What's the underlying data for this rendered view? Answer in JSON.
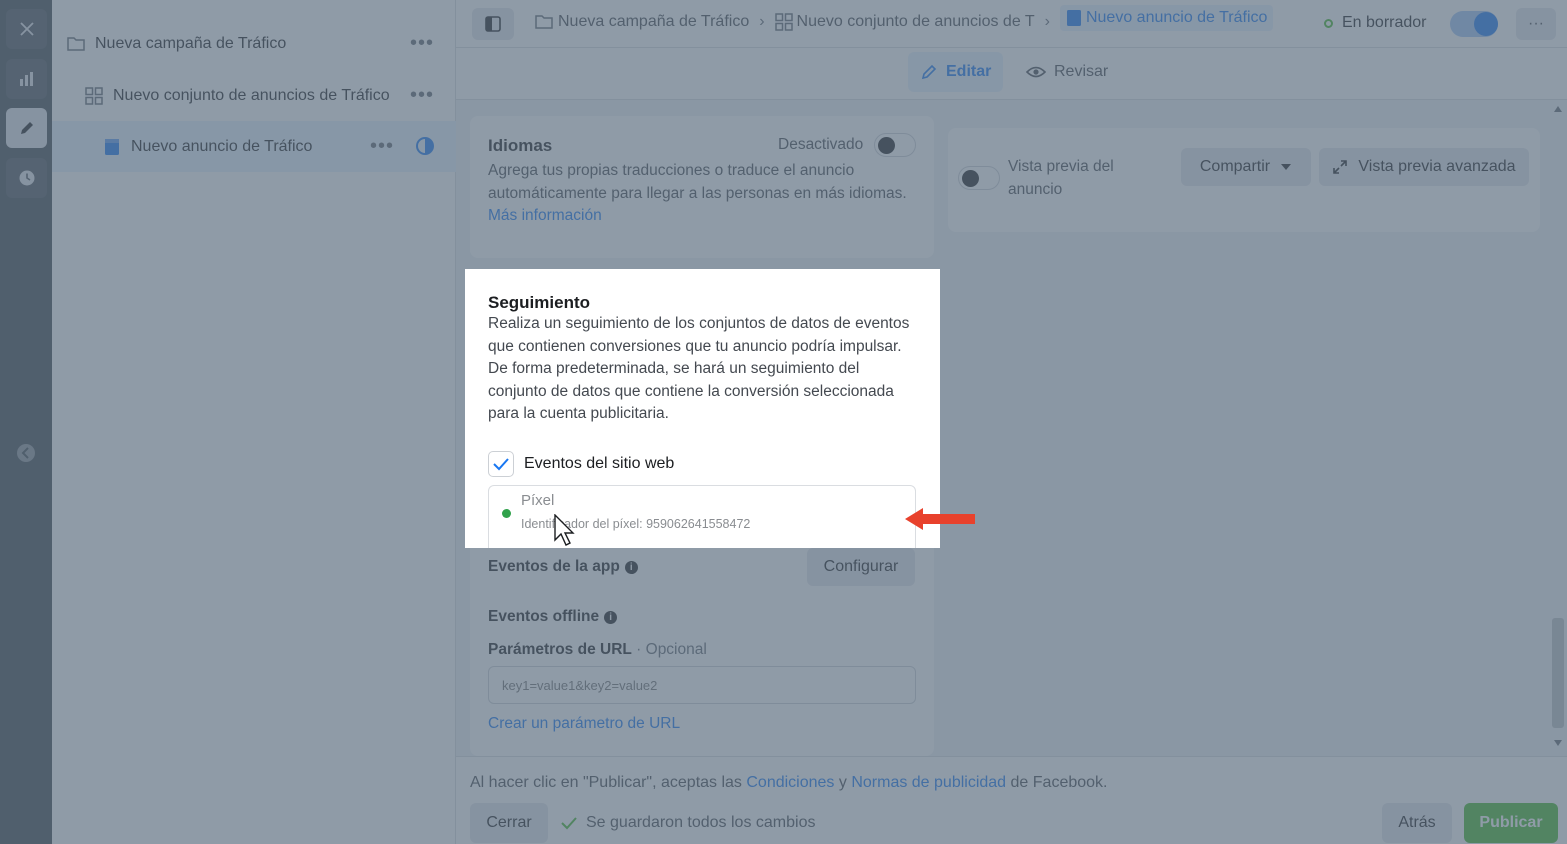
{
  "tree": {
    "campaign": "Nueva campaña de Tráfico",
    "adset": "Nuevo conjunto de anuncios de Tráfico",
    "ad": "Nuevo anuncio de Tráfico",
    "more": "•••"
  },
  "topbar": {
    "crumb_campaign": "Nueva campaña de Tráfico",
    "crumb_adset": "Nuevo conjunto de anuncios de T",
    "crumb_ad": "Nuevo anuncio de Tráfico",
    "status": "En borrador",
    "more": "···"
  },
  "modes": {
    "edit": "Editar",
    "review": "Revisar"
  },
  "languages": {
    "title": "Idiomas",
    "toggle_label": "Desactivado",
    "description": "Agrega tus propias traducciones o traduce el anuncio automáticamente para llegar a las personas en más idiomas.",
    "link": "Más información"
  },
  "preview": {
    "toggle_label": "Vista previa del anuncio",
    "share": "Compartir",
    "advanced": "Vista previa avanzada"
  },
  "tracking": {
    "title": "Seguimiento",
    "description": "Realiza un seguimiento de los conjuntos de datos de eventos que contienen conversiones que tu anuncio podría impulsar. De forma predeterminada, se hará un seguimiento del conjunto de datos que contiene la conversión seleccionada para la cuenta publicitaria.",
    "website_events": "Eventos del sitio web",
    "pixel_title": "Píxel",
    "pixel_id": "Identificador del píxel: 959062641558472",
    "app_events": "Eventos de la app",
    "configure": "Configurar",
    "offline_events": "Eventos offline",
    "url_params_label": "Parámetros de URL",
    "url_params_optional": " · Opcional",
    "url_params_placeholder": "key1=value1&key2=value2",
    "create_url_param": "Crear un parámetro de URL"
  },
  "footer": {
    "terms_prefix": "Al hacer clic en \"Publicar\", aceptas las ",
    "terms_conditions": "Condiciones",
    "terms_and": " y ",
    "terms_policies": "Normas de publicidad",
    "terms_suffix": " de Facebook.",
    "close": "Cerrar",
    "saved": "Se guardaron todos los cambios",
    "back": "Atrás",
    "publish": "Publicar"
  },
  "colors": {
    "accent": "#1877f2",
    "publish": "#42b72a",
    "status_dot": "#42b72a",
    "arrow": "#e8412c"
  },
  "icons": [
    "close-icon",
    "chart-icon",
    "pencil-icon",
    "clock-icon",
    "folder-icon",
    "grid-icon",
    "ad-icon",
    "half-circle-icon",
    "sidebar-icon",
    "eye-icon",
    "check-icon",
    "expand-icon",
    "info-icon",
    "chevron-left-icon"
  ]
}
